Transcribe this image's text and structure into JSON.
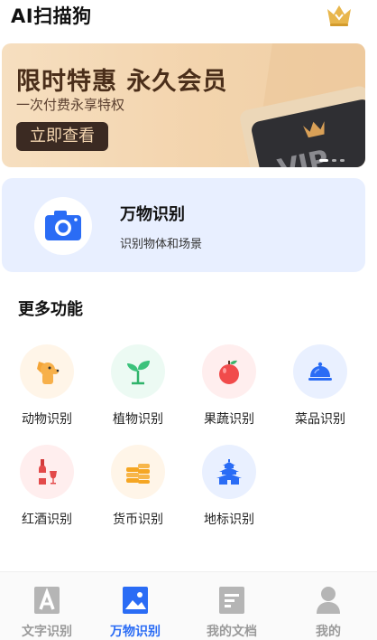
{
  "header": {
    "title": "AI扫描狗"
  },
  "banner": {
    "title": "限时特惠 永久会员",
    "subtitle": "一次付费永享特权",
    "button_label": "立即查看",
    "card_text": "VIP",
    "slide_count": 3,
    "active_slide": 1
  },
  "feature_card": {
    "title": "万物识别",
    "subtitle": "识别物体和场景"
  },
  "more_section": {
    "title": "更多功能",
    "items": [
      {
        "label": "动物识别",
        "icon": "dog-icon"
      },
      {
        "label": "植物识别",
        "icon": "sprout-icon"
      },
      {
        "label": "果蔬识别",
        "icon": "apple-icon"
      },
      {
        "label": "菜品识别",
        "icon": "food-cloche-icon"
      },
      {
        "label": "红酒识别",
        "icon": "wine-icon"
      },
      {
        "label": "货币识别",
        "icon": "coins-icon"
      },
      {
        "label": "地标识别",
        "icon": "temple-icon"
      }
    ]
  },
  "tabbar": {
    "tabs": [
      {
        "label": "文字识别",
        "icon": "text-a-icon",
        "active": false
      },
      {
        "label": "万物识别",
        "icon": "image-icon",
        "active": true
      },
      {
        "label": "我的文档",
        "icon": "document-icon",
        "active": false
      },
      {
        "label": "我的",
        "icon": "user-icon",
        "active": false
      }
    ]
  },
  "colors": {
    "accent": "#2a6cf5",
    "feature_bg": "#e8efff",
    "banner_button": "#3b2a22",
    "inactive_tab": "#9a9a9a"
  }
}
